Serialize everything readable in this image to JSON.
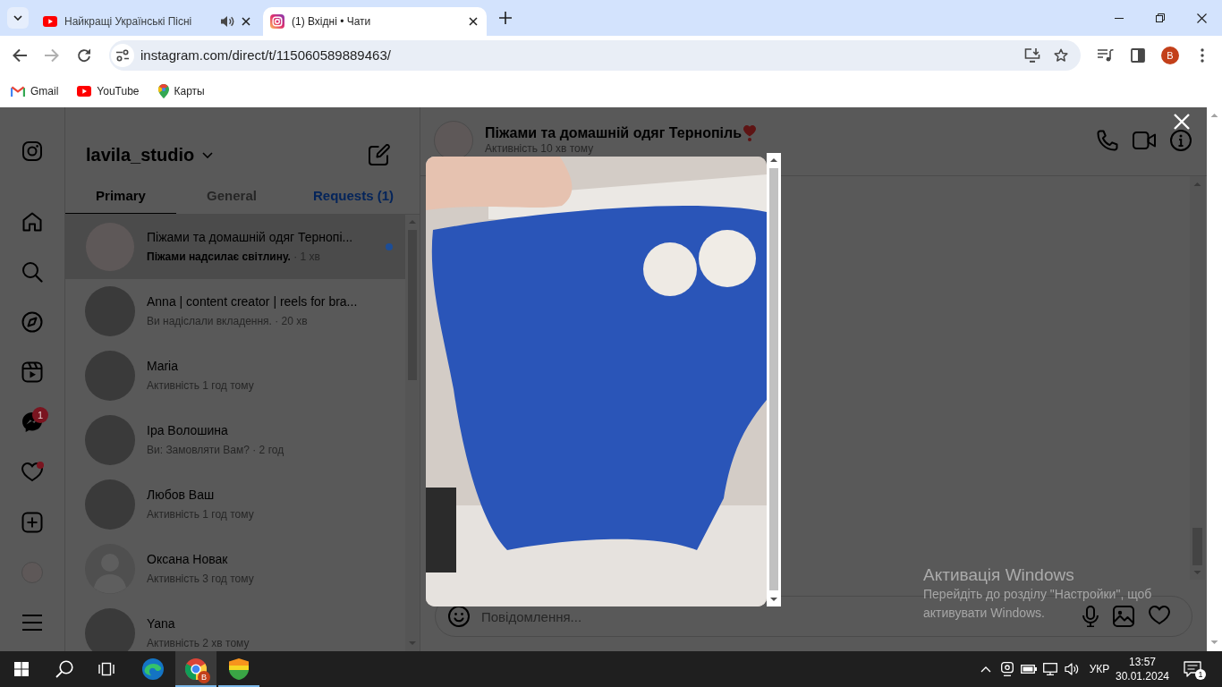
{
  "browser": {
    "tabs": [
      {
        "kind": "video",
        "title": "Найкращі Українські Пісні",
        "audio": true,
        "selected": false
      },
      {
        "kind": "camera",
        "title": "(1) Вхідні • Чати",
        "audio": false,
        "selected": true
      }
    ],
    "can_go_forward": false,
    "address": "instagram.com/direct/t/115060589889463/",
    "profile": "B",
    "bookmarks": [
      {
        "kind": "mail",
        "label": "Gmail"
      },
      {
        "kind": "video",
        "label": "YouTube"
      },
      {
        "kind": "map",
        "label": "Карты"
      }
    ]
  },
  "nav_rail": {
    "messages_badge": "1",
    "notifications_unseen": true
  },
  "inbox": {
    "account": "lavila_studio",
    "tabs": [
      {
        "label": "Primary",
        "kind": "tab",
        "selected": true
      },
      {
        "label": "General",
        "kind": "tab",
        "selected": false
      },
      {
        "label": "Requests (1)",
        "kind": "requests",
        "selected": false
      }
    ],
    "threads": [
      {
        "kind": "logo",
        "name": "Піжами та домашній одяг Тернопі...",
        "subtitle": "**Піжами надсилає світлину.** · 1 хв",
        "unread": true,
        "selected": true
      },
      {
        "kind": "photo",
        "name": "Anna | content creator | reels for bra...",
        "subtitle": "Ви надіслали вкладення. · 20 хв",
        "unread": false,
        "selected": false
      },
      {
        "kind": "photo",
        "name": "Maria",
        "subtitle": "Активність 1 год тому",
        "unread": false,
        "selected": false
      },
      {
        "kind": "photo",
        "name": "Іра Волошина",
        "subtitle": "Ви: Замовляти Вам? · 2 год",
        "unread": false,
        "selected": false
      },
      {
        "kind": "photo",
        "name": "Любов Ваш",
        "subtitle": "Активність 1 год тому",
        "unread": false,
        "selected": false
      },
      {
        "kind": "default",
        "name": "Оксана Новак",
        "subtitle": "Активність 3 год тому",
        "unread": false,
        "selected": false
      },
      {
        "kind": "photo",
        "name": "Yana",
        "subtitle": "Активність 2 хв тому",
        "unread": false,
        "selected": false
      }
    ]
  },
  "chat": {
    "name": "Піжами та домашній одяг Тернопіль",
    "status": "Активність 10 хв тому",
    "composer": {
      "placeholder": "Повідомлення..."
    }
  },
  "lightbox": {
    "open": true
  },
  "activation_notice": {
    "title": "Активація Windows",
    "lines": [
      "Перейдіть до розділу \"Настройки\", щоб",
      "активувати Windows."
    ]
  },
  "taskbar": {
    "apps": [
      {
        "kind": "wave",
        "running": false,
        "selected": false
      },
      {
        "kind": "ring",
        "running": true,
        "selected": true,
        "badge": "B"
      },
      {
        "kind": "shield",
        "running": true,
        "selected": false
      }
    ],
    "language": "УКР",
    "time": "13:57",
    "date": "30.01.2024",
    "notifications": "1"
  }
}
